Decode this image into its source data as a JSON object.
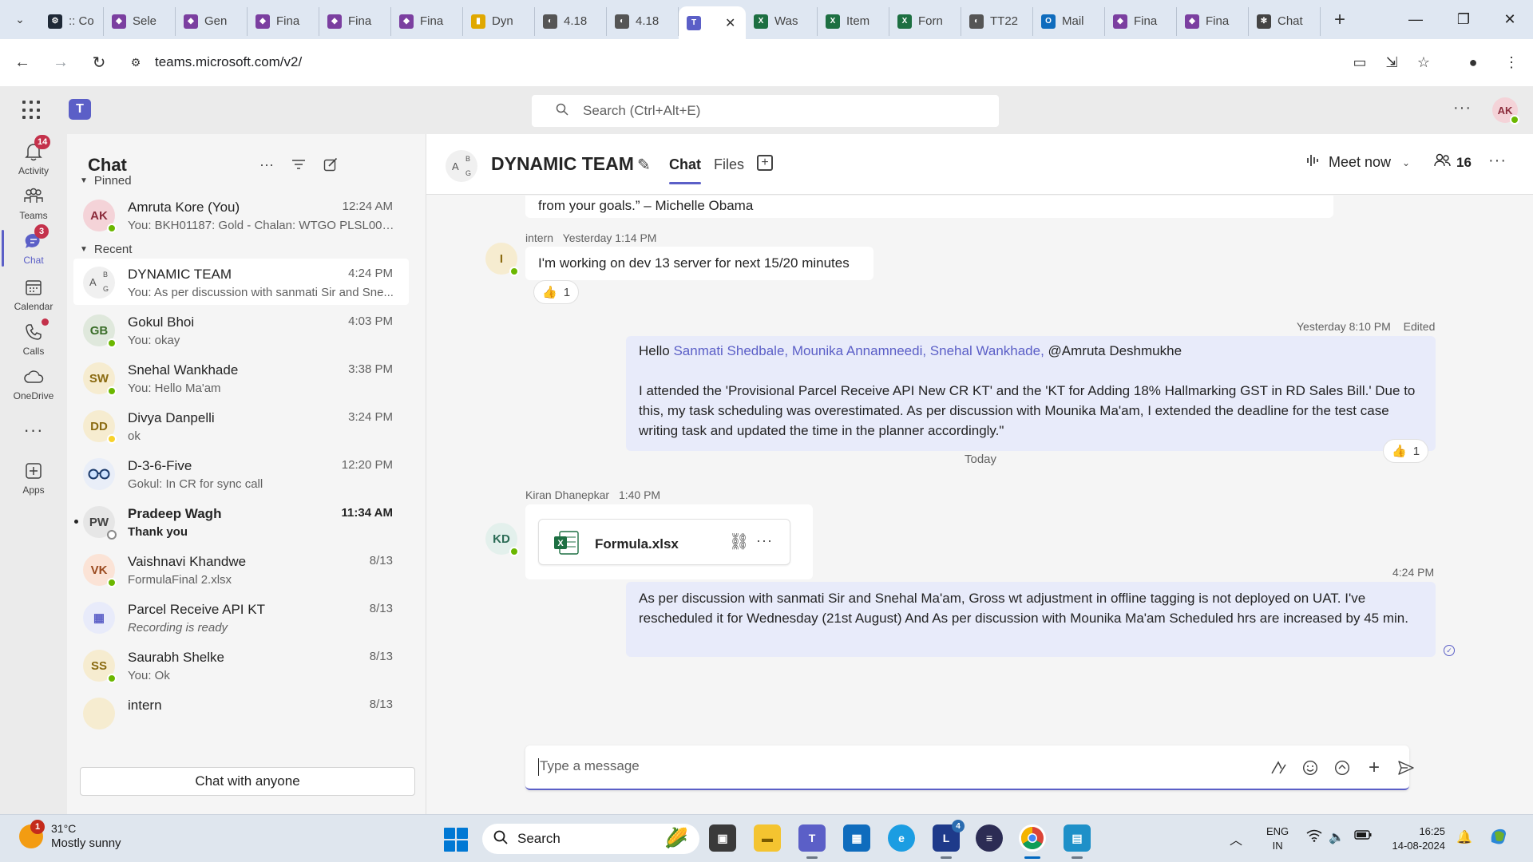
{
  "browser": {
    "tabs": [
      {
        "label": ":: Co",
        "fav_color": "#1f2937",
        "fav_text": "⚙"
      },
      {
        "label": "Sele",
        "fav_color": "#7b3fa0",
        "fav_text": "◆"
      },
      {
        "label": "Gen",
        "fav_color": "#7b3fa0",
        "fav_text": "◆"
      },
      {
        "label": "Fina",
        "fav_color": "#7b3fa0",
        "fav_text": "◆"
      },
      {
        "label": "Fina",
        "fav_color": "#7b3fa0",
        "fav_text": "◆"
      },
      {
        "label": "Fina",
        "fav_color": "#7b3fa0",
        "fav_text": "◆"
      },
      {
        "label": "Dyn",
        "fav_color": "#e0a800",
        "fav_text": "▮"
      },
      {
        "label": "4.18",
        "fav_color": "#555555",
        "fav_text": "◐"
      },
      {
        "label": "4.18",
        "fav_color": "#555555",
        "fav_text": "◐"
      },
      {
        "label": "",
        "fav_color": "#5b5fc7",
        "fav_text": "T",
        "active": true
      },
      {
        "label": "Was",
        "fav_color": "#1d6f42",
        "fav_text": "X"
      },
      {
        "label": "Item",
        "fav_color": "#1d6f42",
        "fav_text": "X"
      },
      {
        "label": "Forn",
        "fav_color": "#1d6f42",
        "fav_text": "X"
      },
      {
        "label": "TT22",
        "fav_color": "#555555",
        "fav_text": "◐"
      },
      {
        "label": "Mail",
        "fav_color": "#0f6cbd",
        "fav_text": "O"
      },
      {
        "label": "Fina",
        "fav_color": "#7b3fa0",
        "fav_text": "◆"
      },
      {
        "label": "Fina",
        "fav_color": "#7b3fa0",
        "fav_text": "◆"
      },
      {
        "label": "Chat",
        "fav_color": "#444444",
        "fav_text": "✻"
      }
    ],
    "url": "teams.microsoft.com/v2/"
  },
  "teams_header": {
    "search_placeholder": "Search (Ctrl+Alt+E)",
    "user_initials": "AK"
  },
  "rail": [
    {
      "label": "Activity",
      "icon": "bell-icon",
      "badge": "14"
    },
    {
      "label": "Teams",
      "icon": "teams-icon"
    },
    {
      "label": "Chat",
      "icon": "chat-icon",
      "badge": "3",
      "active": true
    },
    {
      "label": "Calendar",
      "icon": "calendar-icon"
    },
    {
      "label": "Calls",
      "icon": "phone-icon",
      "dot": true
    },
    {
      "label": "OneDrive",
      "icon": "cloud-icon"
    },
    {
      "label": "",
      "icon": "more-icon"
    },
    {
      "label": "Apps",
      "icon": "apps-icon"
    }
  ],
  "chat_list": {
    "title": "Chat",
    "pinned_label": "Pinned",
    "recent_label": "Recent",
    "chat_with_anyone": "Chat with anyone",
    "pinned": [
      {
        "initials": "AK",
        "name": "Amruta Kore (You)",
        "preview": "You: BKH01187: Gold - Chalan: WTGO PLSL007...",
        "time": "12:24 AM",
        "av_bg": "#f4d3d8",
        "av_fg": "#8b2b3b",
        "presence": "online"
      }
    ],
    "recent": [
      {
        "initials": "A",
        "name": "DYNAMIC TEAM",
        "preview": "You: As per discussion with sanmati Sir and Sne...",
        "time": "4:24 PM",
        "av_bg": "#f0f0f0",
        "av_fg": "#555555",
        "presence": "",
        "selected": true,
        "group": true
      },
      {
        "initials": "GB",
        "name": "Gokul Bhoi",
        "preview": "You: okay",
        "time": "4:03 PM",
        "av_bg": "#dfe8dc",
        "av_fg": "#3b6e2a",
        "presence": "online"
      },
      {
        "initials": "SW",
        "name": "Snehal Wankhade",
        "preview": "You: Hello Ma'am",
        "time": "3:38 PM",
        "av_bg": "#f6ecd0",
        "av_fg": "#8a6a10",
        "presence": "online"
      },
      {
        "initials": "DD",
        "name": "Divya Danpelli",
        "preview": "ok",
        "time": "3:24 PM",
        "av_bg": "#f6ecd0",
        "av_fg": "#8a6a10",
        "presence": "away"
      },
      {
        "initials": "",
        "name": "D-3-6-Five",
        "preview": "Gokul: In CR for sync call",
        "time": "12:20 PM",
        "av_bg": "#e9eef8",
        "av_fg": "#1b3a6b",
        "presence": "",
        "glasses": true
      },
      {
        "initials": "PW",
        "name": "Pradeep Wagh",
        "preview": "Thank you",
        "time": "11:34 AM",
        "av_bg": "#e6e6e6",
        "av_fg": "#424242",
        "presence": "off",
        "unread": true
      },
      {
        "initials": "VK",
        "name": "Vaishnavi Khandwe",
        "preview": "FormulaFinal 2.xlsx",
        "time": "8/13",
        "av_bg": "#fbe3d6",
        "av_fg": "#9a4a1f",
        "presence": "online"
      },
      {
        "initials": "▦",
        "name": "Parcel Receive API KT",
        "preview": "Recording is ready",
        "time": "8/13",
        "av_bg": "#e8ebfa",
        "av_fg": "#5b5fc7",
        "presence": "",
        "italic": true
      },
      {
        "initials": "SS",
        "name": "Saurabh Shelke",
        "preview": "You: Ok",
        "time": "8/13",
        "av_bg": "#f6ecd0",
        "av_fg": "#8a6a10",
        "presence": "online"
      },
      {
        "initials": "",
        "name": "intern",
        "preview": "",
        "time": "8/13",
        "av_bg": "#f6ecd0",
        "av_fg": "#8a6a10",
        "presence": ""
      }
    ]
  },
  "chat_header": {
    "title": "DYNAMIC TEAM",
    "avatar_letters": [
      "A",
      "B",
      "G"
    ],
    "tab_chat": "Chat",
    "tab_files": "Files",
    "meet_now": "Meet now",
    "participants": "16"
  },
  "messages": {
    "quote_tail": "from your goals.” – Michelle Obama",
    "intern_msg": {
      "sender": "intern",
      "time": "Yesterday 1:14 PM",
      "initials": "I",
      "text": "I'm working on dev 13 server for next 15/20 minutes",
      "reaction_emoji": "👍",
      "reaction_count": "1"
    },
    "my_msg_1": {
      "time": "Yesterday 8:10 PM",
      "edited": "Edited",
      "greeting": "Hello ",
      "mentions": "Sanmati Shedbale, Mounika Annamneedi, Snehal Wankhade,",
      "plain_mention": " @Amruta Deshmukhe",
      "body": "I attended the 'Provisional Parcel Receive API New CR KT' and the 'KT for Adding 18% Hallmarking GST in RD Sales Bill.' Due to this, my task scheduling was overestimated. As per discussion with Mounika Ma'am, I extended the deadline for the test case writing task and updated the time in the planner accordingly.\"",
      "reaction_emoji": "👍",
      "reaction_count": "1"
    },
    "day_separator": "Today",
    "kd_msg": {
      "sender": "Kiran Dhanepkar",
      "time": "1:40 PM",
      "initials": "KD",
      "file_name": "Formula.xlsx"
    },
    "my_msg_2": {
      "time": "4:24 PM",
      "body": "As per discussion with sanmati Sir and Snehal Ma'am, Gross wt adjustment in offline tagging is not deployed on UAT. I've rescheduled it for Wednesday (21st August) And As per discussion with Mounika Ma'am Scheduled hrs are increased by 45 min."
    }
  },
  "composer": {
    "placeholder": "Type a message"
  },
  "taskbar": {
    "weather_temp": "31°C",
    "weather_cond": "Mostly sunny",
    "weather_badge": "1",
    "search_label": "Search",
    "lang_1": "ENG",
    "lang_2": "IN",
    "time": "16:25",
    "date": "14-08-2024",
    "l_badge": "4"
  },
  "colors": {
    "accent": "#5b5fc7",
    "my_bubble": "#e8ebfa",
    "presence_online": "#6bb700",
    "badge_red": "#c4314b"
  }
}
